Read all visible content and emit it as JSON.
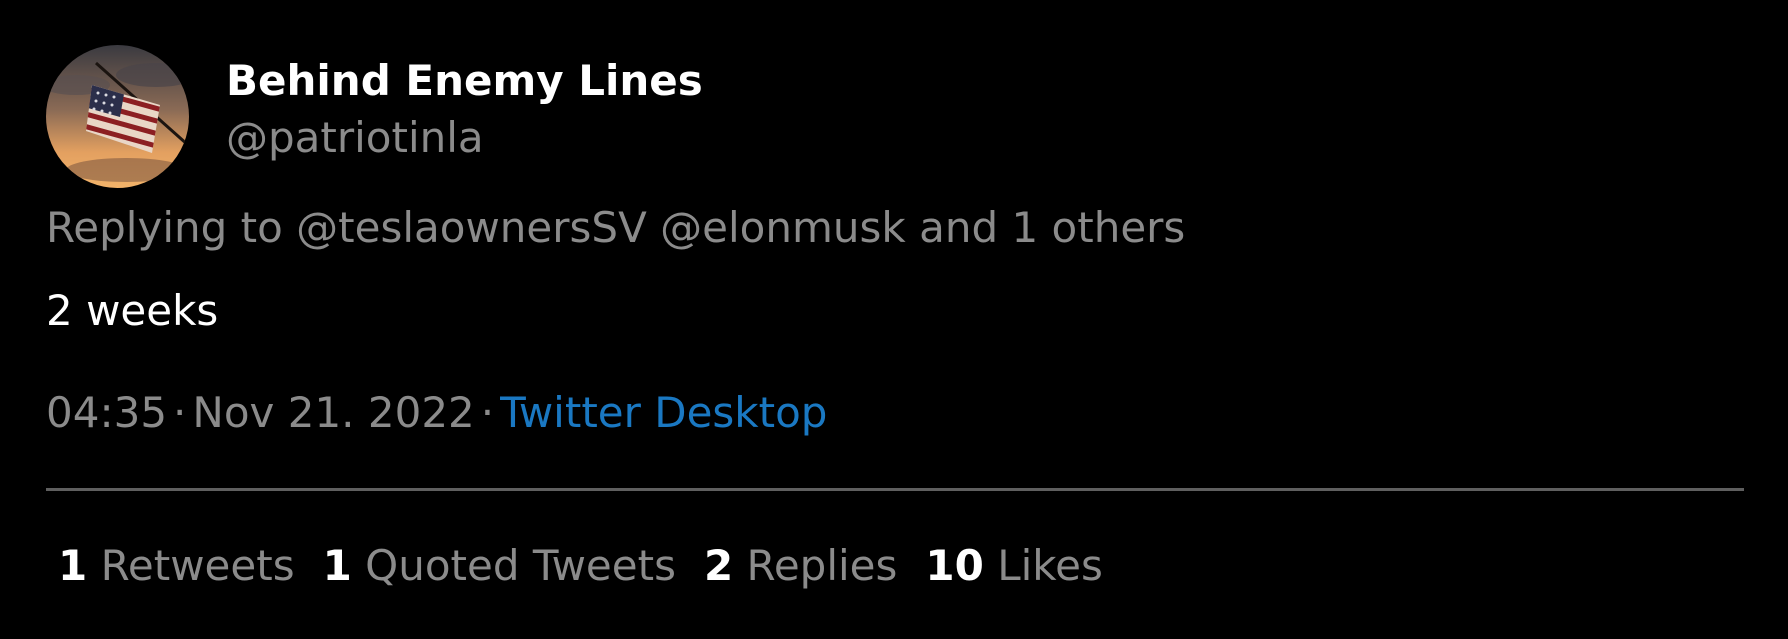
{
  "tweet": {
    "author": {
      "display_name": "Behind Enemy Lines",
      "handle": "@patriotinla",
      "avatar_icon": "american-flag-sunset-avatar"
    },
    "reply": {
      "prefix": "Replying to",
      "mentions": [
        "@teslaownersSV",
        "@elonmusk"
      ],
      "suffix": "and 1 others"
    },
    "text": "2 weeks",
    "meta": {
      "time": "04:35",
      "date": "Nov 21. 2022",
      "separator": "·",
      "source": "Twitter Desktop"
    },
    "stats": [
      {
        "count": "1",
        "label": "Retweets"
      },
      {
        "count": "1",
        "label": "Quoted Tweets"
      },
      {
        "count": "2",
        "label": "Replies"
      },
      {
        "count": "10",
        "label": "Likes"
      }
    ]
  },
  "colors": {
    "background": "#000000",
    "primary_text": "#ffffff",
    "secondary_text": "#8b8b8b",
    "link": "#1a78c2",
    "divider": "#5f5f5f"
  }
}
